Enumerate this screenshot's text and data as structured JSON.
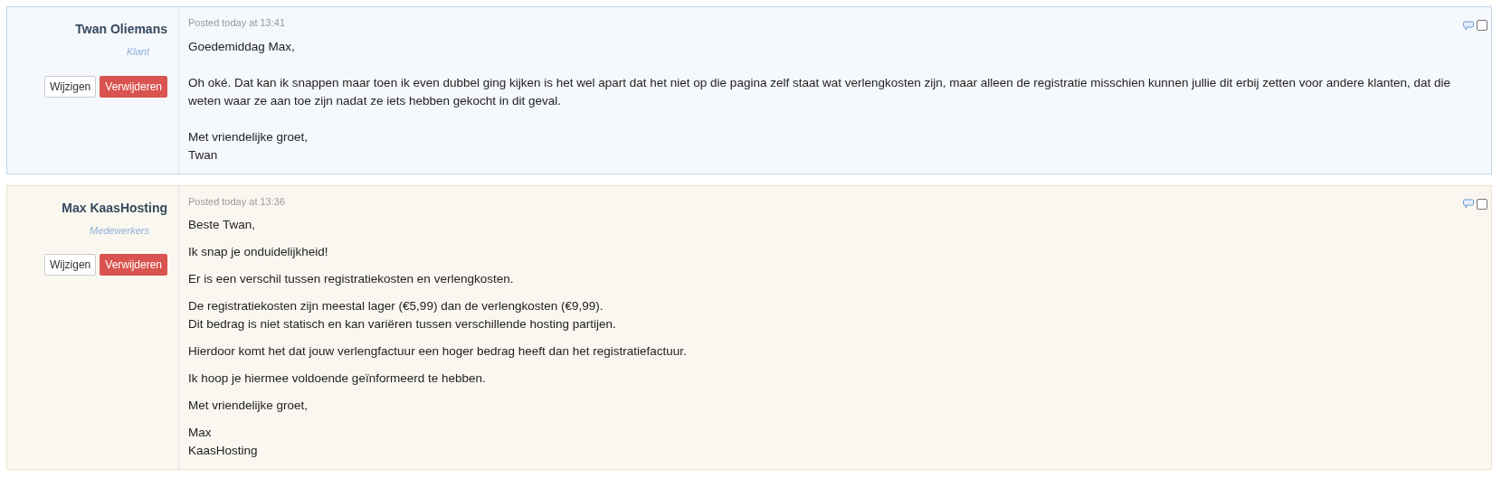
{
  "posts": [
    {
      "kind": "client",
      "author": "Twan Oliemans",
      "role": "Klant",
      "buttons": [
        "Wijzigen",
        "Verwijderen"
      ],
      "posted": "Posted today at 13:41",
      "checked": false,
      "paragraphs": [
        [
          "Goedemiddag Max,"
        ],
        [
          "Oh oké. Dat kan ik snappen maar toen ik even dubbel ging kijken is het wel apart dat het niet op die pagina zelf staat wat verlengkosten zijn, maar alleen de registratie misschien kunnen jullie dit erbij zetten voor andere klanten, dat die weten waar ze aan toe zijn nadat ze iets hebben gekocht in dit geval."
        ],
        [
          "Met vriendelijke groet,",
          "Twan"
        ]
      ]
    },
    {
      "kind": "staff",
      "author": "Max KaasHosting",
      "role": "Medewerkers",
      "buttons": [
        "Wijzigen",
        "Verwijderen"
      ],
      "posted": "Posted today at 13:36",
      "checked": false,
      "paragraphs": [
        [
          "Beste Twan,"
        ],
        [
          "Ik snap je onduidelijkheid!"
        ],
        [
          "Er is een verschil tussen registratiekosten en verlengkosten."
        ],
        [
          "De registratiekosten zijn meestal lager (€5,99) dan de verlengkosten (€9,99).",
          "Dit bedrag is niet statisch en kan variëren tussen verschillende hosting partijen."
        ],
        [
          "Hierdoor komt het dat jouw verlengfactuur een hoger bedrag heeft dan het registratiefactuur."
        ],
        [
          "Ik hoop je hiermee voldoende geïnformeerd te hebben."
        ],
        [
          "Met vriendelijke groet,"
        ],
        [
          "Max",
          "KaasHosting"
        ]
      ]
    }
  ]
}
